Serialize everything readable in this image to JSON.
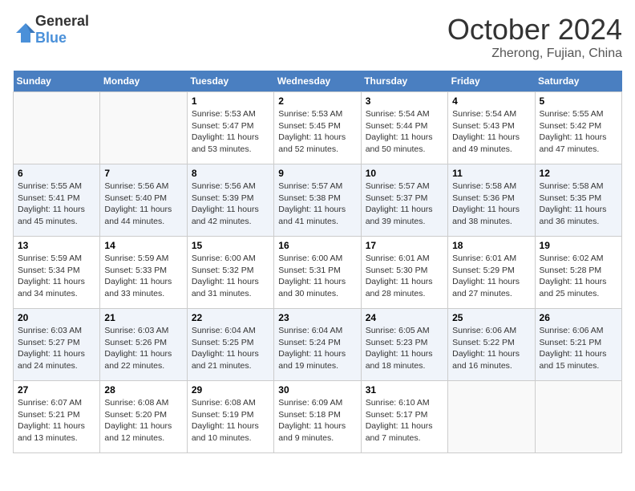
{
  "logo": {
    "general": "General",
    "blue": "Blue"
  },
  "header": {
    "month": "October 2024",
    "location": "Zherong, Fujian, China"
  },
  "weekdays": [
    "Sunday",
    "Monday",
    "Tuesday",
    "Wednesday",
    "Thursday",
    "Friday",
    "Saturday"
  ],
  "weeks": [
    [
      {
        "day": "",
        "sunrise": "",
        "sunset": "",
        "daylight": ""
      },
      {
        "day": "",
        "sunrise": "",
        "sunset": "",
        "daylight": ""
      },
      {
        "day": "1",
        "sunrise": "Sunrise: 5:53 AM",
        "sunset": "Sunset: 5:47 PM",
        "daylight": "Daylight: 11 hours and 53 minutes."
      },
      {
        "day": "2",
        "sunrise": "Sunrise: 5:53 AM",
        "sunset": "Sunset: 5:45 PM",
        "daylight": "Daylight: 11 hours and 52 minutes."
      },
      {
        "day": "3",
        "sunrise": "Sunrise: 5:54 AM",
        "sunset": "Sunset: 5:44 PM",
        "daylight": "Daylight: 11 hours and 50 minutes."
      },
      {
        "day": "4",
        "sunrise": "Sunrise: 5:54 AM",
        "sunset": "Sunset: 5:43 PM",
        "daylight": "Daylight: 11 hours and 49 minutes."
      },
      {
        "day": "5",
        "sunrise": "Sunrise: 5:55 AM",
        "sunset": "Sunset: 5:42 PM",
        "daylight": "Daylight: 11 hours and 47 minutes."
      }
    ],
    [
      {
        "day": "6",
        "sunrise": "Sunrise: 5:55 AM",
        "sunset": "Sunset: 5:41 PM",
        "daylight": "Daylight: 11 hours and 45 minutes."
      },
      {
        "day": "7",
        "sunrise": "Sunrise: 5:56 AM",
        "sunset": "Sunset: 5:40 PM",
        "daylight": "Daylight: 11 hours and 44 minutes."
      },
      {
        "day": "8",
        "sunrise": "Sunrise: 5:56 AM",
        "sunset": "Sunset: 5:39 PM",
        "daylight": "Daylight: 11 hours and 42 minutes."
      },
      {
        "day": "9",
        "sunrise": "Sunrise: 5:57 AM",
        "sunset": "Sunset: 5:38 PM",
        "daylight": "Daylight: 11 hours and 41 minutes."
      },
      {
        "day": "10",
        "sunrise": "Sunrise: 5:57 AM",
        "sunset": "Sunset: 5:37 PM",
        "daylight": "Daylight: 11 hours and 39 minutes."
      },
      {
        "day": "11",
        "sunrise": "Sunrise: 5:58 AM",
        "sunset": "Sunset: 5:36 PM",
        "daylight": "Daylight: 11 hours and 38 minutes."
      },
      {
        "day": "12",
        "sunrise": "Sunrise: 5:58 AM",
        "sunset": "Sunset: 5:35 PM",
        "daylight": "Daylight: 11 hours and 36 minutes."
      }
    ],
    [
      {
        "day": "13",
        "sunrise": "Sunrise: 5:59 AM",
        "sunset": "Sunset: 5:34 PM",
        "daylight": "Daylight: 11 hours and 34 minutes."
      },
      {
        "day": "14",
        "sunrise": "Sunrise: 5:59 AM",
        "sunset": "Sunset: 5:33 PM",
        "daylight": "Daylight: 11 hours and 33 minutes."
      },
      {
        "day": "15",
        "sunrise": "Sunrise: 6:00 AM",
        "sunset": "Sunset: 5:32 PM",
        "daylight": "Daylight: 11 hours and 31 minutes."
      },
      {
        "day": "16",
        "sunrise": "Sunrise: 6:00 AM",
        "sunset": "Sunset: 5:31 PM",
        "daylight": "Daylight: 11 hours and 30 minutes."
      },
      {
        "day": "17",
        "sunrise": "Sunrise: 6:01 AM",
        "sunset": "Sunset: 5:30 PM",
        "daylight": "Daylight: 11 hours and 28 minutes."
      },
      {
        "day": "18",
        "sunrise": "Sunrise: 6:01 AM",
        "sunset": "Sunset: 5:29 PM",
        "daylight": "Daylight: 11 hours and 27 minutes."
      },
      {
        "day": "19",
        "sunrise": "Sunrise: 6:02 AM",
        "sunset": "Sunset: 5:28 PM",
        "daylight": "Daylight: 11 hours and 25 minutes."
      }
    ],
    [
      {
        "day": "20",
        "sunrise": "Sunrise: 6:03 AM",
        "sunset": "Sunset: 5:27 PM",
        "daylight": "Daylight: 11 hours and 24 minutes."
      },
      {
        "day": "21",
        "sunrise": "Sunrise: 6:03 AM",
        "sunset": "Sunset: 5:26 PM",
        "daylight": "Daylight: 11 hours and 22 minutes."
      },
      {
        "day": "22",
        "sunrise": "Sunrise: 6:04 AM",
        "sunset": "Sunset: 5:25 PM",
        "daylight": "Daylight: 11 hours and 21 minutes."
      },
      {
        "day": "23",
        "sunrise": "Sunrise: 6:04 AM",
        "sunset": "Sunset: 5:24 PM",
        "daylight": "Daylight: 11 hours and 19 minutes."
      },
      {
        "day": "24",
        "sunrise": "Sunrise: 6:05 AM",
        "sunset": "Sunset: 5:23 PM",
        "daylight": "Daylight: 11 hours and 18 minutes."
      },
      {
        "day": "25",
        "sunrise": "Sunrise: 6:06 AM",
        "sunset": "Sunset: 5:22 PM",
        "daylight": "Daylight: 11 hours and 16 minutes."
      },
      {
        "day": "26",
        "sunrise": "Sunrise: 6:06 AM",
        "sunset": "Sunset: 5:21 PM",
        "daylight": "Daylight: 11 hours and 15 minutes."
      }
    ],
    [
      {
        "day": "27",
        "sunrise": "Sunrise: 6:07 AM",
        "sunset": "Sunset: 5:21 PM",
        "daylight": "Daylight: 11 hours and 13 minutes."
      },
      {
        "day": "28",
        "sunrise": "Sunrise: 6:08 AM",
        "sunset": "Sunset: 5:20 PM",
        "daylight": "Daylight: 11 hours and 12 minutes."
      },
      {
        "day": "29",
        "sunrise": "Sunrise: 6:08 AM",
        "sunset": "Sunset: 5:19 PM",
        "daylight": "Daylight: 11 hours and 10 minutes."
      },
      {
        "day": "30",
        "sunrise": "Sunrise: 6:09 AM",
        "sunset": "Sunset: 5:18 PM",
        "daylight": "Daylight: 11 hours and 9 minutes."
      },
      {
        "day": "31",
        "sunrise": "Sunrise: 6:10 AM",
        "sunset": "Sunset: 5:17 PM",
        "daylight": "Daylight: 11 hours and 7 minutes."
      },
      {
        "day": "",
        "sunrise": "",
        "sunset": "",
        "daylight": ""
      },
      {
        "day": "",
        "sunrise": "",
        "sunset": "",
        "daylight": ""
      }
    ]
  ]
}
